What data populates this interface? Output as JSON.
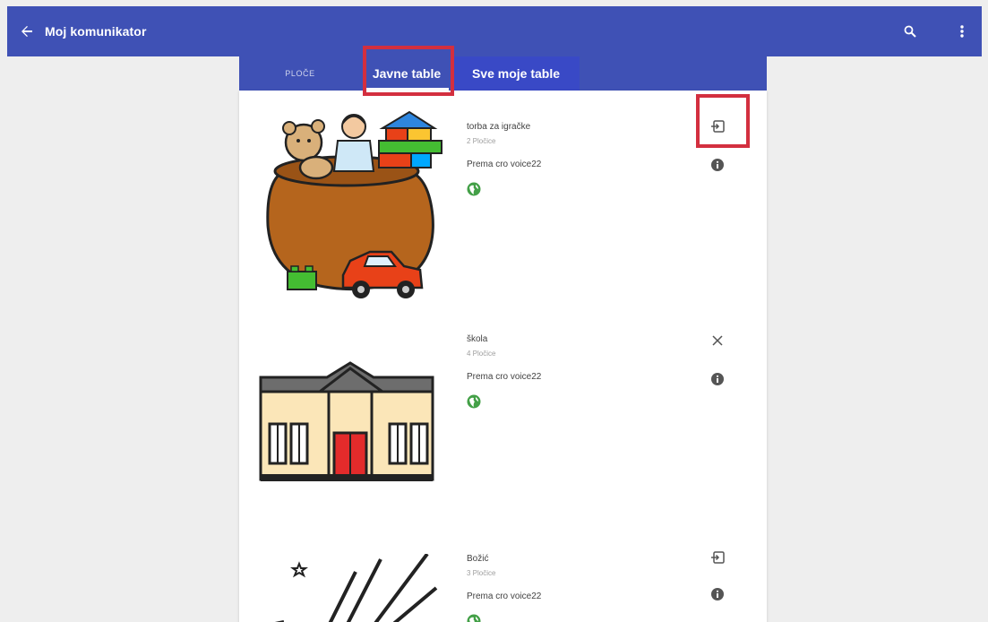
{
  "app": {
    "title": "Moj komunikator",
    "bar_color": "#3f51b5"
  },
  "tabs": [
    {
      "label": "PLOČE"
    },
    {
      "label": "Javne table"
    },
    {
      "label": "Sve moje table"
    }
  ],
  "boards": [
    {
      "name": "torba za igračke",
      "count": "2 Pločice",
      "author": "Prema cro voice22",
      "action_icon": "open-board-icon",
      "visibility_icon": "globe-icon"
    },
    {
      "name": "škola",
      "count": "4 Pločice",
      "author": "Prema cro voice22",
      "action_icon": "close-icon",
      "visibility_icon": "globe-icon"
    },
    {
      "name": "Božić",
      "count": "3 Pločice",
      "author": "Prema cro voice22",
      "action_icon": "open-board-icon",
      "visibility_icon": "globe-icon"
    }
  ],
  "colors": {
    "accent": "#3f51b5",
    "annotation": "#d32f3f",
    "globe": "#43a047"
  }
}
